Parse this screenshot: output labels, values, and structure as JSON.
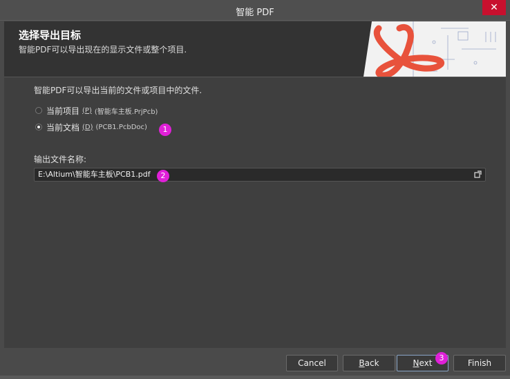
{
  "window": {
    "title": "智能 PDF",
    "close_glyph": "✕"
  },
  "header": {
    "title": "选择导出目标",
    "subtitle": "智能PDF可以导出现在的显示文件或整个项目."
  },
  "content": {
    "description": "智能PDF可以导出当前的文件或项目中的文件.",
    "options": [
      {
        "label": "当前项目",
        "key": "(P)",
        "detail": "(智能车主板.PrjPcb)",
        "checked": false
      },
      {
        "label": "当前文档",
        "key": "(D)",
        "detail": "(PCB1.PcbDoc)",
        "checked": true
      }
    ],
    "output_label": "输出文件名称:",
    "output_path": "E:\\Altium\\智能车主板\\PCB1.pdf"
  },
  "annotations": [
    "1",
    "2",
    "3"
  ],
  "footer": {
    "cancel": "Cancel",
    "back_first": "B",
    "back_rest": "ack",
    "next_first": "N",
    "next_rest": "ext",
    "finish": "Finish"
  },
  "colors": {
    "badge": "#e020d8",
    "close": "#c8102e",
    "acrobat": "#e8523c"
  }
}
